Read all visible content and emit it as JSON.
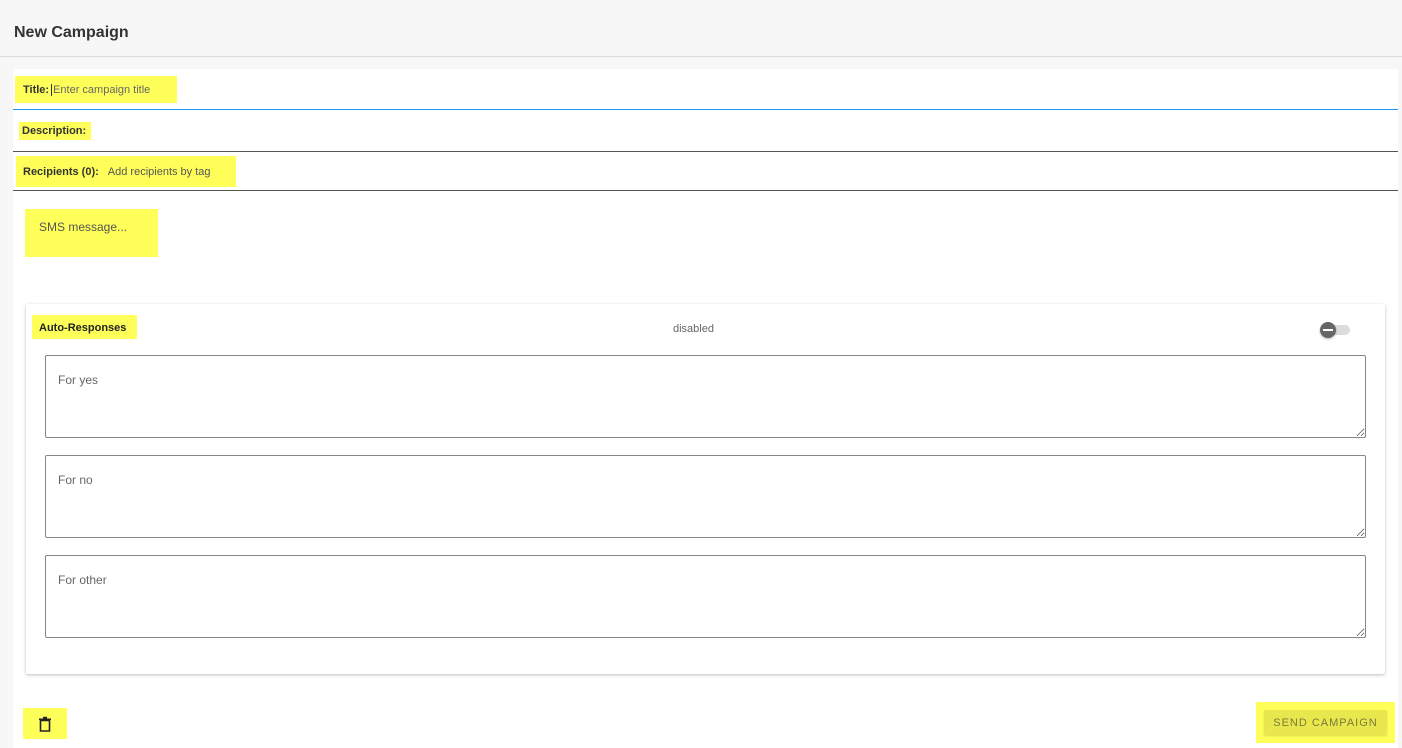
{
  "header": {
    "title": "New Campaign"
  },
  "form": {
    "title_label": "Title:",
    "title_placeholder": "Enter campaign title",
    "description_label": "Description:",
    "recipients_label": "Recipients (0):",
    "recipients_placeholder": "Add recipients by tag",
    "sms_placeholder": "SMS message..."
  },
  "auto_responses": {
    "title": "Auto-Responses",
    "status": "disabled",
    "enabled": false,
    "fields": [
      {
        "placeholder": "For yes"
      },
      {
        "placeholder": "For no"
      },
      {
        "placeholder": "For other"
      }
    ]
  },
  "footer": {
    "send_label": "SEND CAMPAIGN",
    "delete_icon": "trash-icon"
  },
  "colors": {
    "highlight": "#ffff5a",
    "focus_underline": "#2196f3",
    "toggle_knob": "#666666"
  }
}
